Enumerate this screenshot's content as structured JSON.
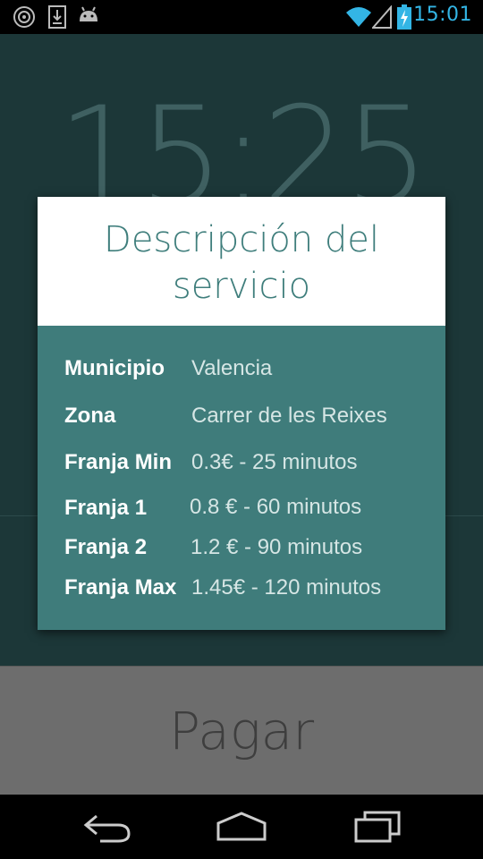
{
  "status_bar": {
    "time": "15:01",
    "left_icons": [
      "hotspot-icon",
      "download-icon",
      "android-icon"
    ],
    "right_icons": [
      "wifi-icon",
      "signal-icon",
      "battery-charging-icon"
    ],
    "accent_color": "#33b5e5"
  },
  "background": {
    "clock": "15:25"
  },
  "dialog": {
    "title_line1": "Descripción del",
    "title_line2": "servicio",
    "rows": [
      {
        "label": "Municipio",
        "value": "Valencia"
      },
      {
        "label": "Zona",
        "value": "Carrer de les Reixes"
      },
      {
        "label": "Franja Min",
        "value": "0.3€ - 25 minutos"
      },
      {
        "label": "Franja 1",
        "value": "0.8 € - 60 minutos"
      },
      {
        "label": "Franja 2",
        "value": "1.2 € - 90 minutos"
      },
      {
        "label": "Franja Max",
        "value": "1.45€ - 120 minutos"
      }
    ]
  },
  "pay_button": {
    "label": "Pagar"
  },
  "nav_bar": {
    "buttons": [
      "back-icon",
      "home-icon",
      "recent-apps-icon"
    ]
  }
}
